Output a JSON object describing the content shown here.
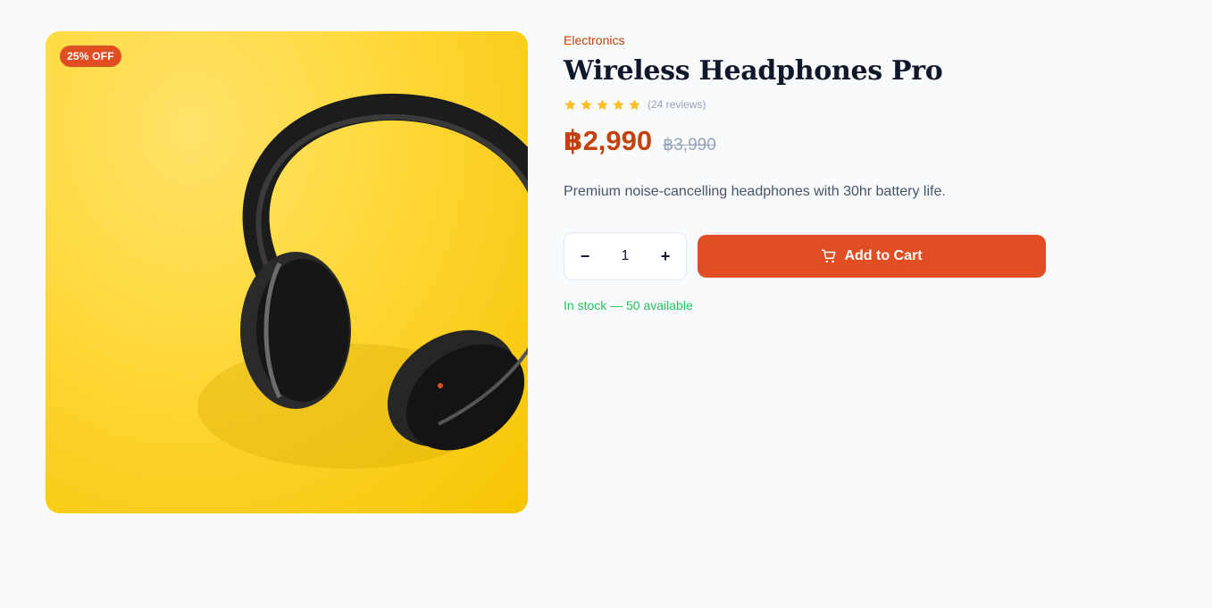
{
  "product": {
    "badge": "25% OFF",
    "image_alt": "Black headphones on yellow background",
    "category": "Electronics",
    "title": "Wireless Headphones Pro",
    "rating": 5,
    "max_rating": 5,
    "reviews_label": "(24 reviews)",
    "price": "฿2,990",
    "old_price": "฿3,990",
    "description": "Premium noise-cancelling headphones with 30hr battery life.",
    "quantity": "1",
    "decrement_label": "−",
    "increment_label": "+",
    "add_to_cart_label": "Add to Cart",
    "stock_text": "In stock — 50 available"
  },
  "colors": {
    "accent": "#e04e23",
    "price": "#c2410c",
    "star": "#fbbf24",
    "stock": "#22c55e",
    "image_bg": "#ffd93d"
  },
  "icons": {
    "cart": "cart-icon",
    "star": "star-icon"
  }
}
